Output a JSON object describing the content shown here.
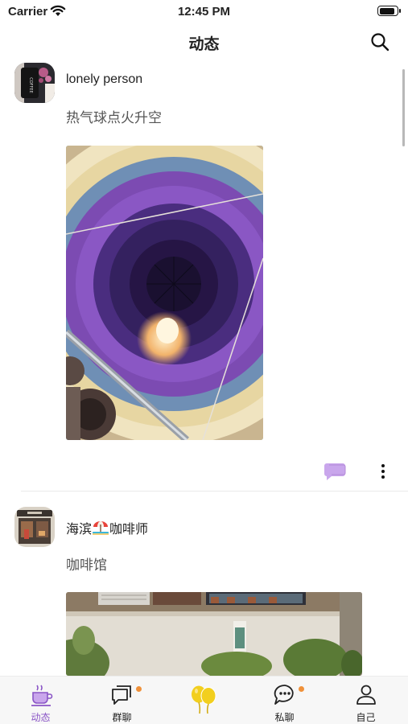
{
  "status_bar": {
    "carrier": "Carrier",
    "time": "12:45 PM",
    "battery_level": 0.9
  },
  "nav": {
    "title": "动态",
    "search_icon": "search-icon"
  },
  "posts": [
    {
      "username": "lonely person",
      "text": "热气球点火升空",
      "avatar_icon": "coffee-cup-avatar",
      "photo_icon": "hot-air-balloon-photo",
      "actions": {
        "comment_icon": "comment-icon",
        "more_icon": "more-vertical-icon"
      }
    },
    {
      "username": "海滨",
      "username_suffix": "咖啡师",
      "emoji": "beach-umbrella-emoji",
      "text": "咖啡馆",
      "avatar_icon": "cafe-storefront-avatar",
      "photo_icon": "cafe-building-photo"
    }
  ],
  "tab_bar": {
    "tabs": [
      {
        "label": "动态",
        "icon": "coffee-cup-icon",
        "active": true,
        "badge": false
      },
      {
        "label": "群聊",
        "icon": "group-chat-icon",
        "active": false,
        "badge": true
      },
      {
        "label": "",
        "icon": "balloons-icon",
        "active": false,
        "badge": false
      },
      {
        "label": "私聊",
        "icon": "private-chat-icon",
        "active": false,
        "badge": true
      },
      {
        "label": "自己",
        "icon": "profile-icon",
        "active": false,
        "badge": false
      }
    ]
  },
  "colors": {
    "accent": "#8a55c6",
    "badge": "#f0913a",
    "balloon": "#f2cf1e",
    "comment": "#c9a6ec"
  }
}
